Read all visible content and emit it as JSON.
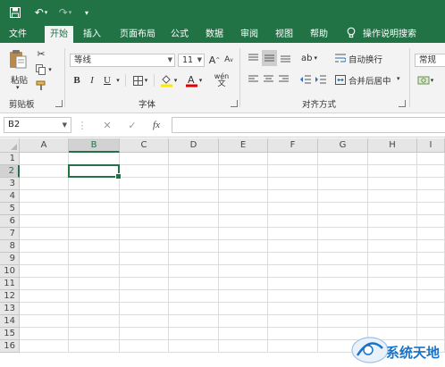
{
  "quick_access": {
    "save_icon": "save-icon",
    "undo_icon": "undo-icon",
    "redo_icon": "redo-icon",
    "customize_icon": "customize-qat-icon"
  },
  "tabs": [
    "文件",
    "开始",
    "插入",
    "页面布局",
    "公式",
    "数据",
    "审阅",
    "视图",
    "帮助",
    "操作说明搜索"
  ],
  "active_tab": "开始",
  "clipboard": {
    "paste_label": "粘贴",
    "group_label": "剪贴板"
  },
  "font": {
    "name": "等线",
    "size": "11",
    "group_label": "字体",
    "bold": "B",
    "italic": "I",
    "underline": "U",
    "grow": "A",
    "shrink": "A",
    "wen": "wén",
    "wen_char": "文"
  },
  "alignment": {
    "wrap_label": "自动换行",
    "merge_label": "合并后居中",
    "group_label": "对齐方式"
  },
  "number": {
    "format": "常规"
  },
  "formula_bar": {
    "name_box": "B2",
    "fx": "fx",
    "value": ""
  },
  "grid": {
    "columns": [
      "A",
      "B",
      "C",
      "D",
      "E",
      "F",
      "G",
      "H",
      "I"
    ],
    "rows": [
      "1",
      "2",
      "3",
      "4",
      "5",
      "6",
      "7",
      "8",
      "9",
      "10",
      "11",
      "12",
      "13",
      "14",
      "15",
      "16"
    ],
    "selected_column": "B",
    "selected_row": "2"
  },
  "watermark": {
    "text": "系统天地"
  },
  "colors": {
    "excel_green": "#217346",
    "ribbon_bg": "#f3f3f3",
    "header_bg": "#e6e6e6",
    "font_color_red": "#e00000",
    "highlight_yellow": "#ffe800"
  }
}
